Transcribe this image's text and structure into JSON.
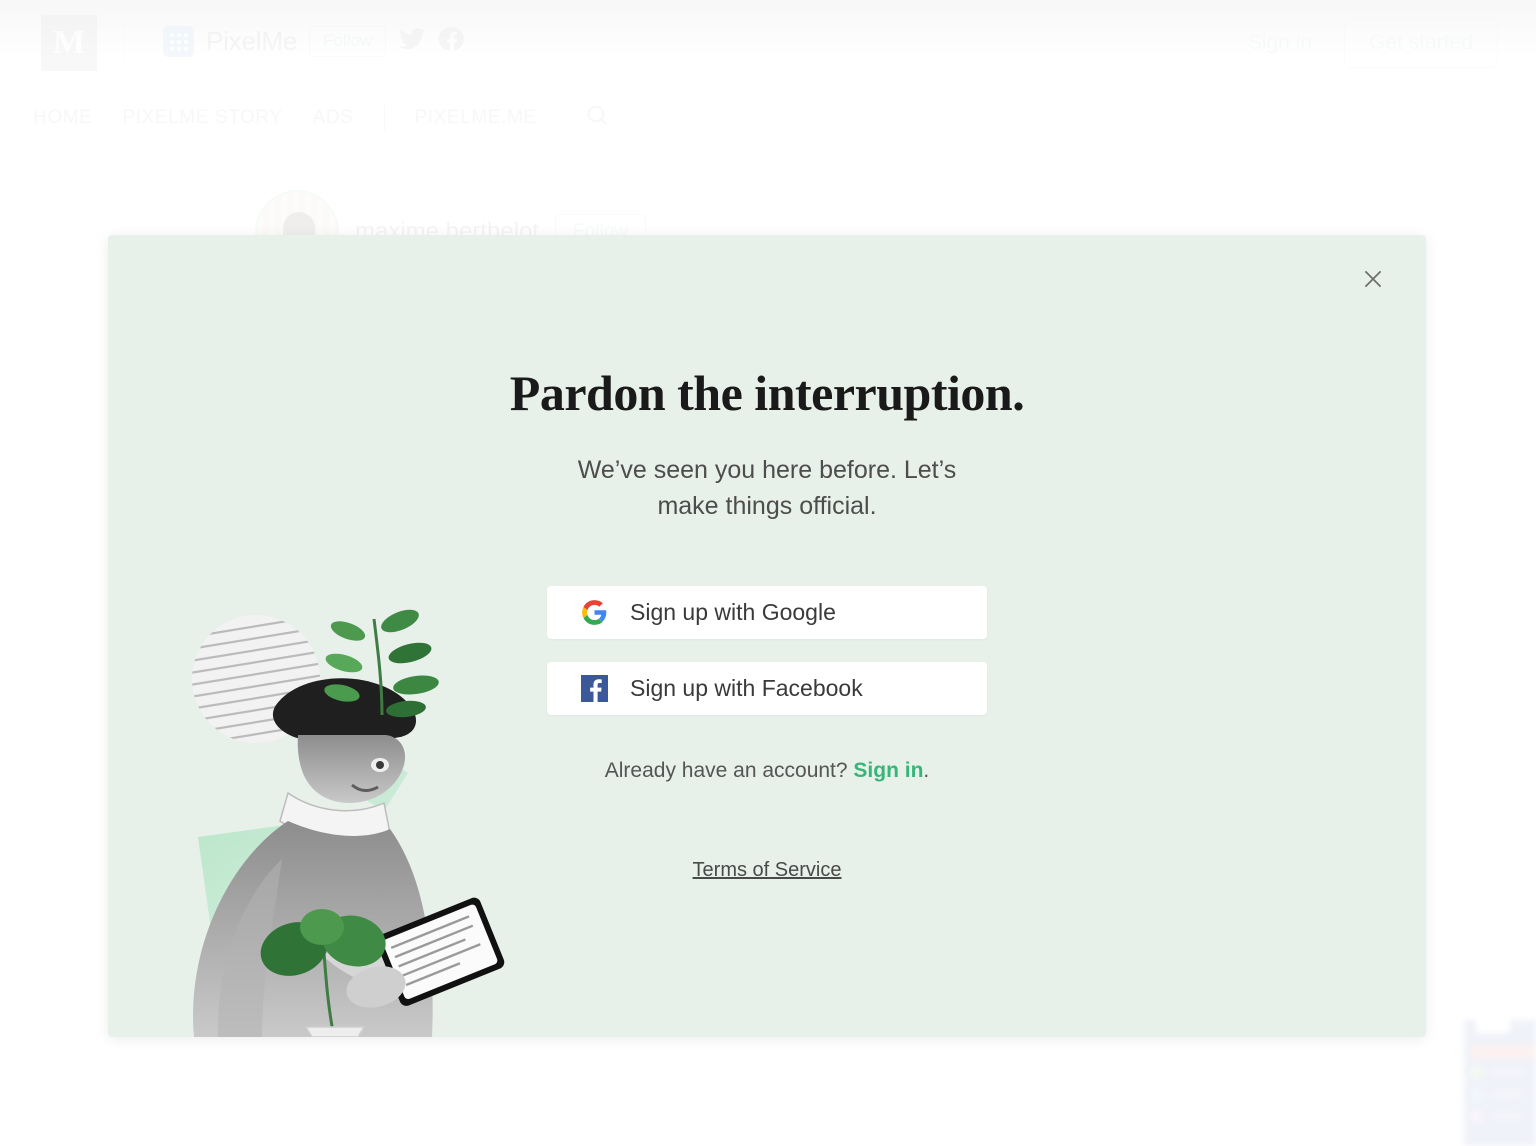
{
  "header": {
    "medium_logo_letter": "M",
    "publication_name": "PixelMe",
    "follow_label": "Follow",
    "twitter_icon": "twitter-icon",
    "facebook_icon": "facebook-icon",
    "sign_in_label": "Sign in",
    "get_started_label": "Get started"
  },
  "nav": {
    "items": [
      "HOME",
      "PIXELME STORY",
      "ADS",
      "PIXELME.ME"
    ],
    "search_icon": "search-icon"
  },
  "byline": {
    "author": "maxime berthelot",
    "follow_label": "Follow"
  },
  "modal": {
    "close_icon": "close-icon",
    "title": "Pardon the interruption.",
    "subtitle": "We’ve seen you here before. Let’s make things official.",
    "google_button": "Sign up with Google",
    "google_icon": "google-g-icon",
    "facebook_button": "Sign up with Facebook",
    "facebook_icon": "facebook-f-icon",
    "already_text": "Already have an account? ",
    "already_link": "Sign in",
    "already_period": ".",
    "terms_label": "Terms of Service",
    "illustration": "person-reading-tablet-collage-illustration"
  },
  "colors": {
    "modal_bg": "#e8f0ea",
    "accent_green": "#37b679",
    "pale_green": "#9fd9b8",
    "page_bg": "#ffffff",
    "medium_grey": "#aaaaaa",
    "pixelme_blue": "#7fb3ea",
    "facebook_blue": "#3b5998"
  }
}
